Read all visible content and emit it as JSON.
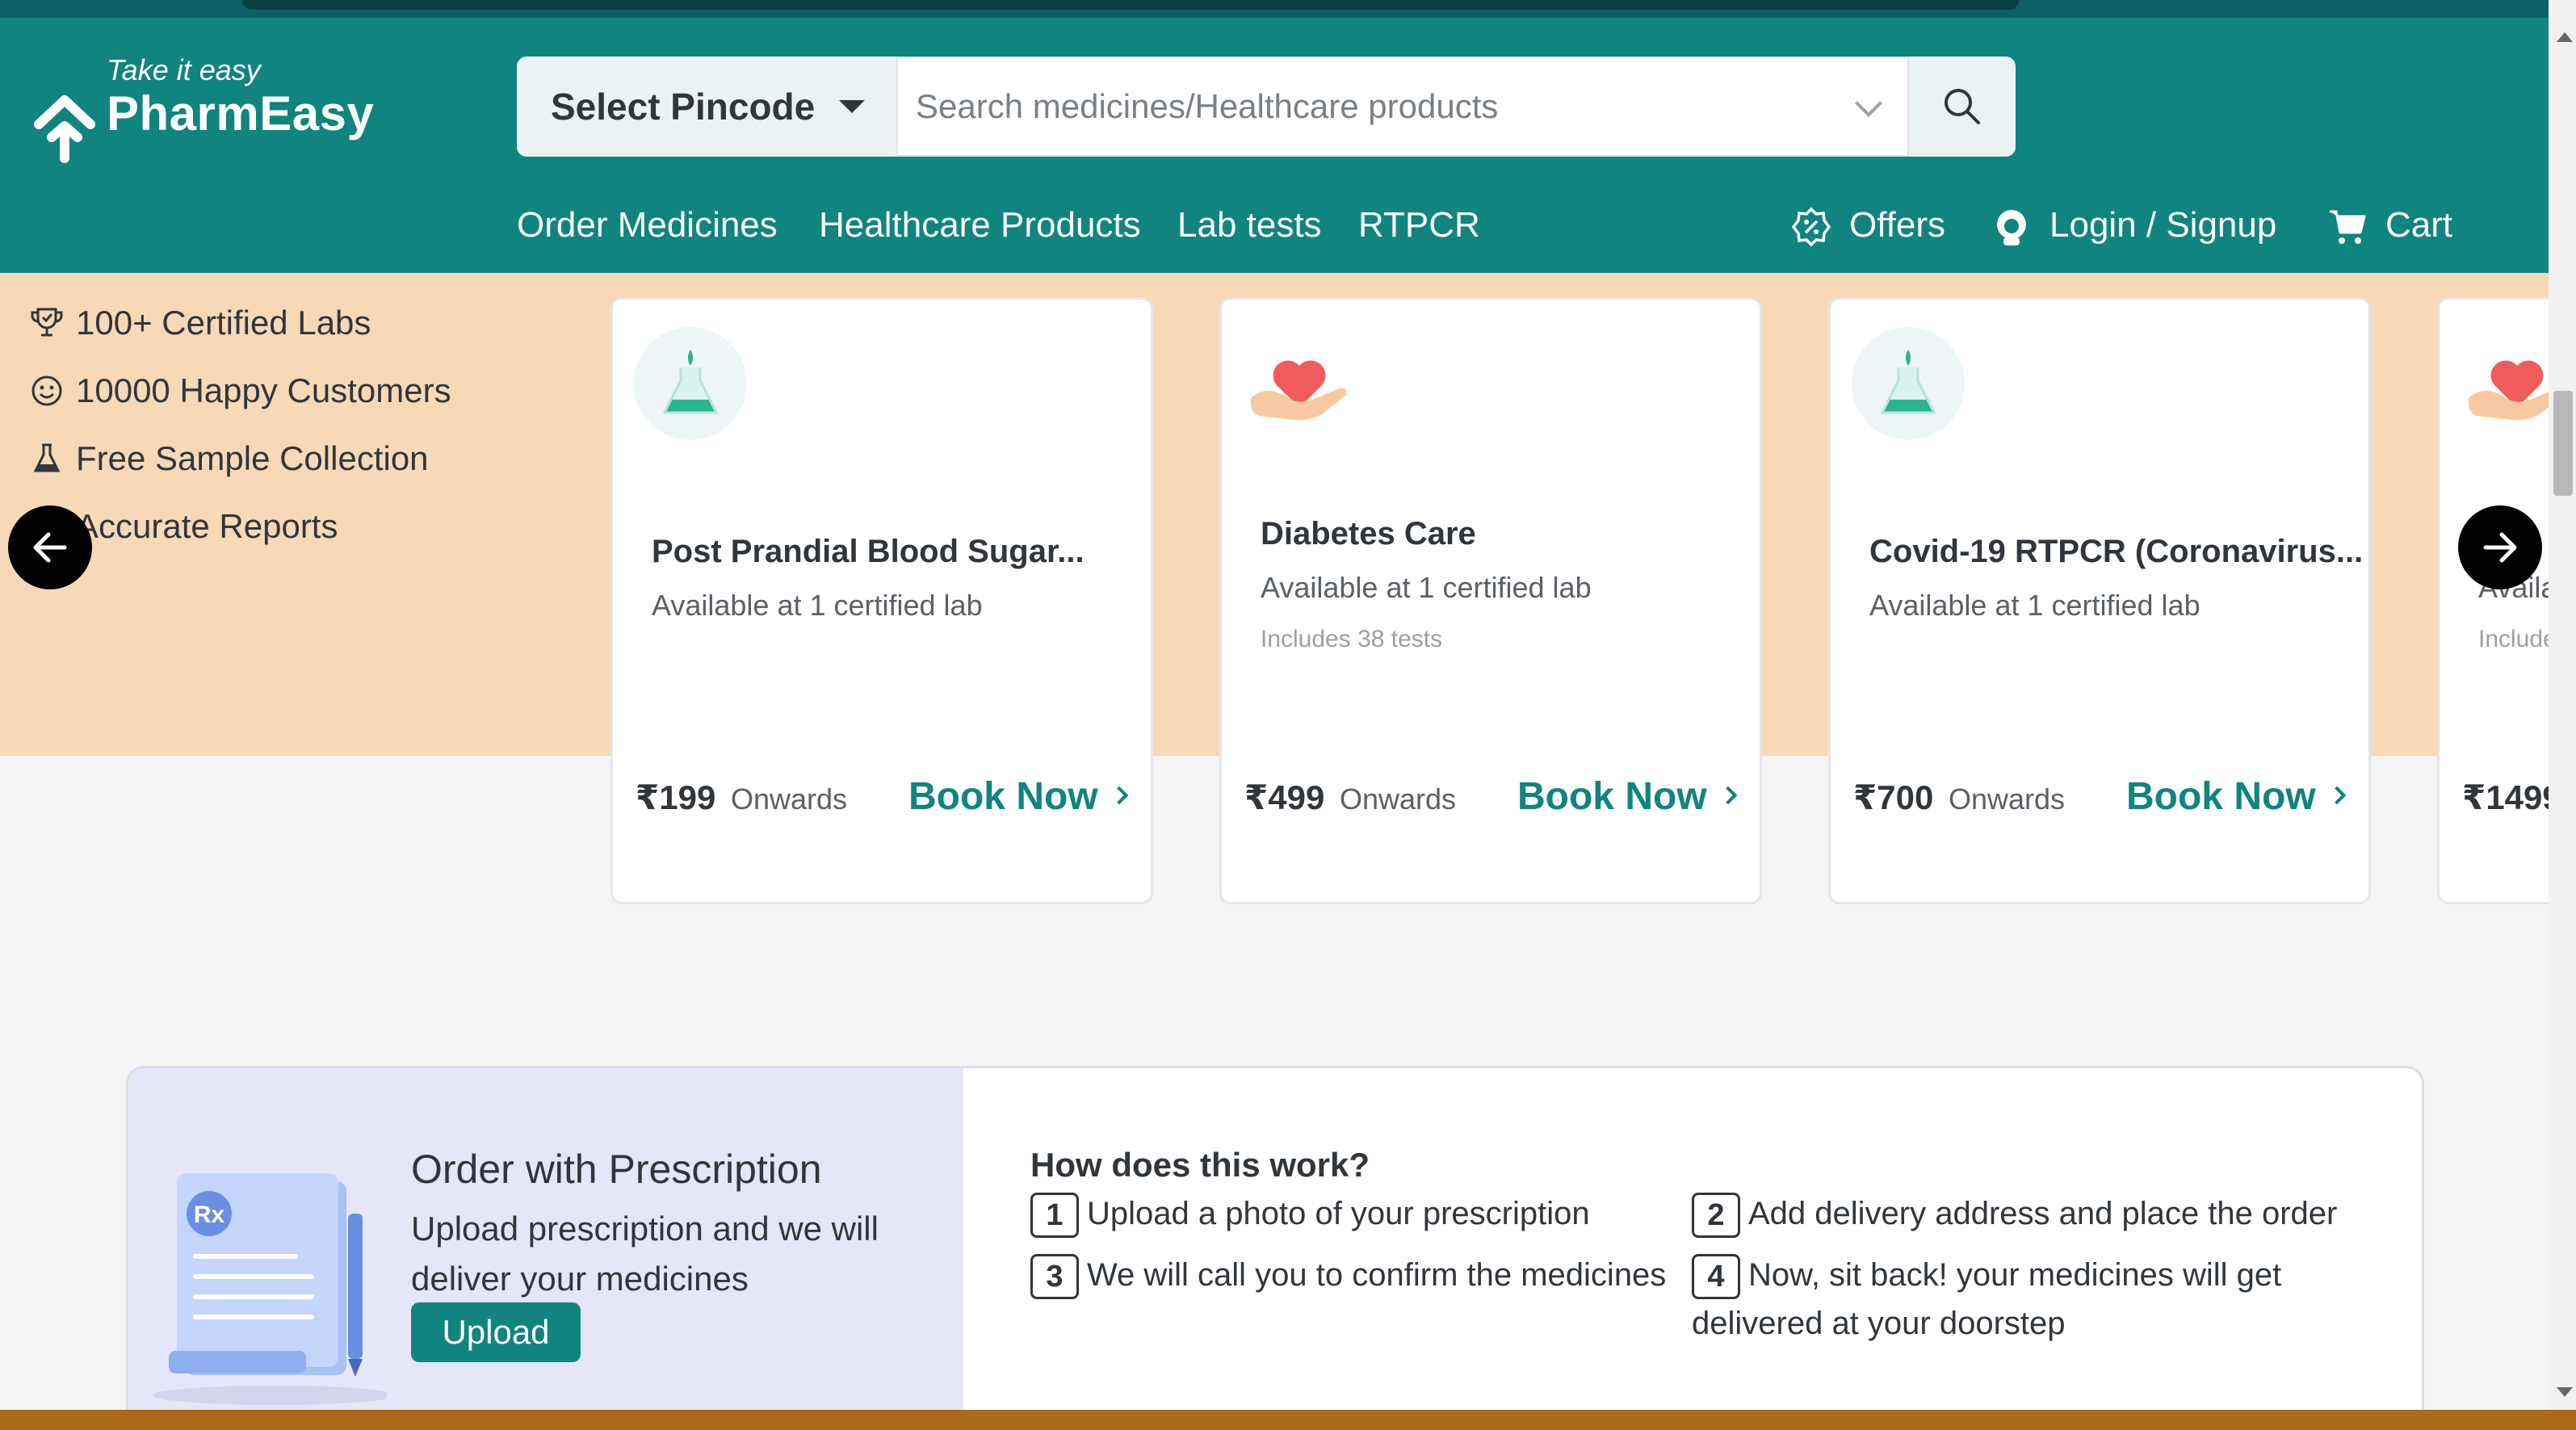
{
  "header": {
    "tagline": "Take it easy",
    "brand": "PharmEasy",
    "pincode_label": "Select Pincode",
    "search_placeholder": "Search medicines/Healthcare products",
    "nav": {
      "order_medicines": "Order Medicines",
      "healthcare_products": "Healthcare Products",
      "lab_tests": "Lab tests",
      "rtpcr": "RTPCR",
      "offers": "Offers",
      "login": "Login / Signup",
      "cart": "Cart"
    }
  },
  "features": [
    {
      "icon": "trophy-icon",
      "label": "100+ Certified Labs"
    },
    {
      "icon": "smiley-icon",
      "label": "10000 Happy Customers"
    },
    {
      "icon": "flask-icon",
      "label": "Free Sample Collection"
    },
    {
      "icon": "report-icon",
      "label": "Accurate Reports"
    }
  ],
  "cards": [
    {
      "icon": "flask-icon",
      "title": "Post Prandial Blood Sugar...",
      "availability": "Available at 1 certified lab",
      "includes": "",
      "price": "₹199",
      "onwards": "Onwards",
      "cta": "Book Now"
    },
    {
      "icon": "heart-hand-icon",
      "title": "Diabetes Care",
      "availability": "Available at 1 certified lab",
      "includes": "Includes 38 tests",
      "price": "₹499",
      "onwards": "Onwards",
      "cta": "Book Now"
    },
    {
      "icon": "flask-icon",
      "title": "Covid-19 RTPCR (Coronavirus...",
      "availability": "Available at 1 certified lab",
      "includes": "",
      "price": "₹700",
      "onwards": "Onwards",
      "cta": "Book Now"
    },
    {
      "icon": "heart-hand-icon",
      "title": "",
      "availability": "Availa",
      "includes": "Include",
      "price": "₹1499",
      "onwards": "",
      "cta": ""
    }
  ],
  "prescription": {
    "badge": "Rx",
    "title": "Order with Prescription",
    "description": "Upload prescription and we will deliver your medicines",
    "upload_label": "Upload",
    "how_title": "How does this work?",
    "steps": [
      {
        "num": "1",
        "text": "Upload a photo of your prescription"
      },
      {
        "num": "2",
        "text": "Add delivery address and place the order"
      },
      {
        "num": "3",
        "text": "We will call you to confirm the medicines"
      },
      {
        "num": "4",
        "text": "Now, sit back! your medicines will get delivered at your doorstep"
      }
    ]
  },
  "colors": {
    "brand": "#10847e",
    "banner": "#f7d9b8",
    "rx_panel": "#e6e6fa"
  }
}
